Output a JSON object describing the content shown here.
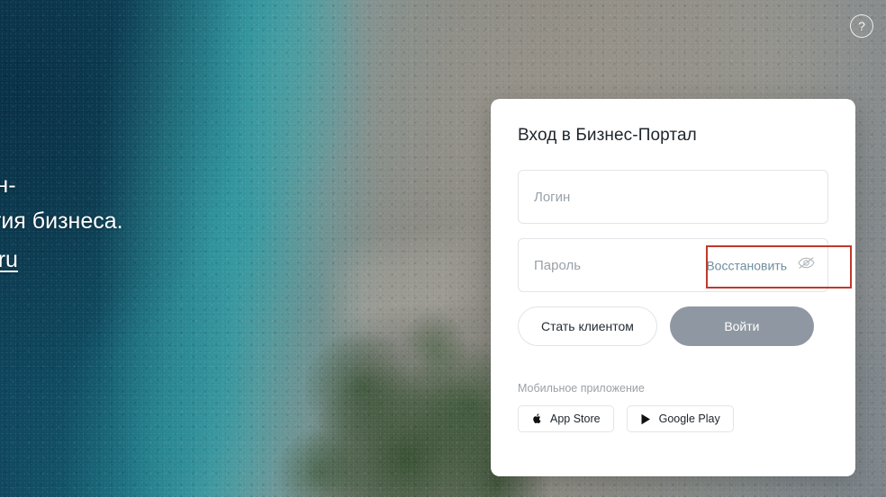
{
  "page": {
    "help_icon": "question-circle-icon"
  },
  "promo": {
    "line1": "ных онлайн-",
    "line2": "для развития бизнеса.",
    "link": "demyopen.ru"
  },
  "card": {
    "title": "Вход в Бизнес-Портал",
    "login": {
      "placeholder": "Логин",
      "value": ""
    },
    "password": {
      "placeholder": "Пароль",
      "value": "",
      "recover_label": "Восстановить",
      "toggle_icon": "eye-off-icon"
    },
    "buttons": {
      "secondary_label": "Стать клиентом",
      "primary_label": "Войти"
    },
    "mobile": {
      "label": "Мобильное приложение",
      "stores": [
        {
          "label": "App Store",
          "icon": "apple-icon"
        },
        {
          "label": "Google Play",
          "icon": "play-triangle-icon"
        }
      ]
    }
  },
  "annotation": {
    "color": "#c0392b",
    "target": "password-recover-and-toggle"
  },
  "colors": {
    "card_background": "#ffffff",
    "primary_button": "#8f98a2",
    "recover_link": "#6d8f9c",
    "placeholder_text": "#9aa1a8",
    "title_text": "#20262c",
    "annotation_red": "#c0392b"
  }
}
